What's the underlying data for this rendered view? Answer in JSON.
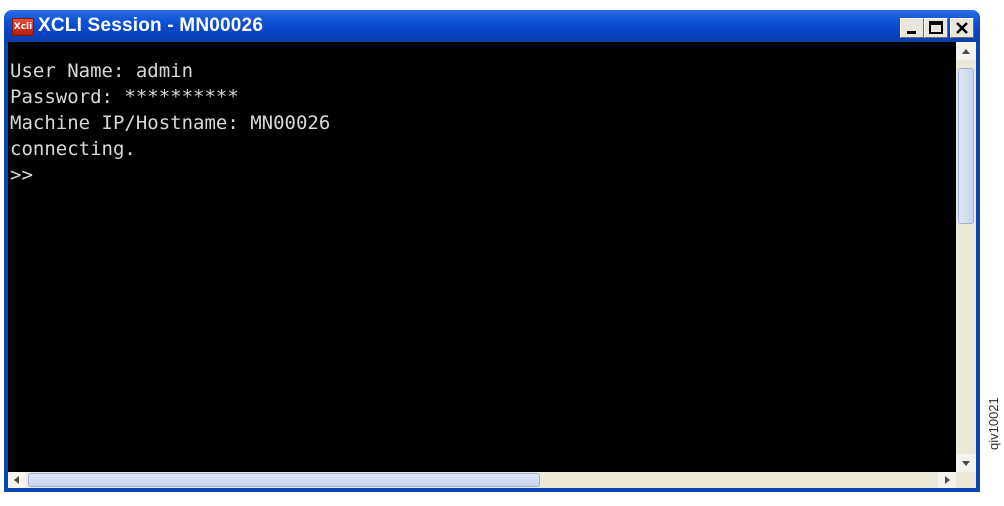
{
  "window": {
    "title": "XCLI Session - MN00026",
    "icon": "xcli-app-icon",
    "controls": [
      "minimize-icon",
      "maximize-icon",
      "close-icon"
    ]
  },
  "terminal": {
    "lines": [
      "User Name: admin",
      "Password: **********",
      "Machine IP/Hostname: MN00026",
      "connecting.",
      ">>"
    ]
  },
  "side_label": "qiv10021",
  "colors": {
    "titlebar": "#0e52d6",
    "terminal_bg": "#000000",
    "terminal_fg": "#d8d8d8"
  }
}
